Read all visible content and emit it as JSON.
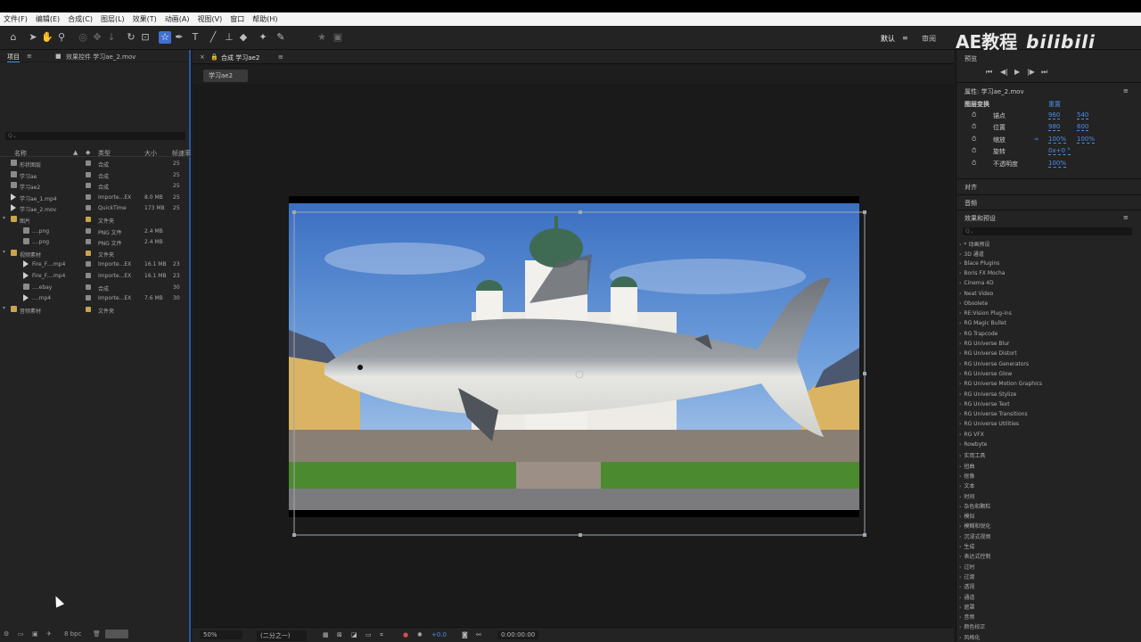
{
  "menu": [
    "文件(F)",
    "编辑(E)",
    "合成(C)",
    "图层(L)",
    "效果(T)",
    "动画(A)",
    "视图(V)",
    "窗口",
    "帮助(H)"
  ],
  "workspace": {
    "default": "默认",
    "review": "审阅"
  },
  "brand": {
    "text": "AE教程",
    "logo": "bilibili"
  },
  "project_panel": {
    "tab_project": "项目",
    "tab_effects": "效果控件 学习ae_2.mov",
    "search_placeholder": "Q⌄",
    "columns": {
      "name": "名称",
      "type": "类型",
      "size": "大小",
      "frame": "帧速率"
    },
    "rows": [
      {
        "name": "形状图层",
        "type": "合成",
        "size": "",
        "frame": "25",
        "kind": "comp",
        "indent": 0
      },
      {
        "name": "学习ae",
        "type": "合成",
        "size": "",
        "frame": "25",
        "kind": "comp",
        "indent": 0
      },
      {
        "name": "学习ae2",
        "type": "合成",
        "size": "",
        "frame": "25",
        "kind": "comp",
        "indent": 0
      },
      {
        "name": "学习ae_1.mp4",
        "type": "Importe...EX",
        "size": "8.0 MB",
        "frame": "25",
        "kind": "video",
        "indent": 0
      },
      {
        "name": "学习ae_2.mov",
        "type": "QuickTime",
        "size": "173 MB",
        "frame": "25",
        "kind": "video",
        "indent": 0
      },
      {
        "name": "图片",
        "type": "文件夹",
        "size": "",
        "frame": "",
        "kind": "folder",
        "indent": 0
      },
      {
        "name": "....png",
        "type": "PNG 文件",
        "size": "2.4 MB",
        "frame": "",
        "kind": "file",
        "indent": 1
      },
      {
        "name": "....png",
        "type": "PNG 文件",
        "size": "2.4 MB",
        "frame": "",
        "kind": "file",
        "indent": 1
      },
      {
        "name": "视频素材",
        "type": "文件夹",
        "size": "",
        "frame": "",
        "kind": "folder",
        "indent": 0
      },
      {
        "name": "Fire_F....mp4",
        "type": "Importe...EX",
        "size": "16.1 MB",
        "frame": "23",
        "kind": "video",
        "indent": 1
      },
      {
        "name": "Fire_F....mp4",
        "type": "Importe...EX",
        "size": "16.1 MB",
        "frame": "23",
        "kind": "video",
        "indent": 1
      },
      {
        "name": "....ebay",
        "type": "合成",
        "size": "",
        "frame": "30",
        "kind": "comp",
        "indent": 1
      },
      {
        "name": "....mp4",
        "type": "Importe...EX",
        "size": "7.6 MB",
        "frame": "30",
        "kind": "video",
        "indent": 1
      },
      {
        "name": "音频素材",
        "type": "文件夹",
        "size": "",
        "frame": "",
        "kind": "folder",
        "indent": 0
      }
    ],
    "footer_bpc": "8 bpc"
  },
  "composition": {
    "tab": "合成 学习ae2",
    "sub_tab": "学习ae2",
    "zoom": "50%",
    "resolution": "(二分之一)",
    "exposure": "+0.0",
    "timecode": "0:00:00:00"
  },
  "right_panel": {
    "preview": "预览",
    "properties_title": "属性: 学习ae_2.mov",
    "layer_transform": "图层变换",
    "reset": "重置",
    "props": [
      {
        "label": "锚点",
        "v1": "960",
        "v2": "540"
      },
      {
        "label": "位置",
        "v1": "980",
        "v2": "600"
      },
      {
        "label": "缩放",
        "v1": "100%",
        "v2": "100%"
      },
      {
        "label": "旋转",
        "v1": "0x+0 °",
        "v2": ""
      },
      {
        "label": "不透明度",
        "v1": "100%",
        "v2": ""
      }
    ],
    "align": "对齐",
    "audio": "音频",
    "effects_presets": "效果和预设",
    "effects_search": "Q⌄",
    "effects": [
      "* 动画预设",
      "3D 通道",
      "Blace Plugins",
      "Boris FX Mocha",
      "Cinema 4D",
      "Neat Video",
      "Obsolete",
      "RE:Vision Plug-ins",
      "RG Magic Bullet",
      "RG Trapcode",
      "RG Universe Blur",
      "RG Universe Distort",
      "RG Universe Generators",
      "RG Universe Glow",
      "RG Universe Motion Graphics",
      "RG Universe Stylize",
      "RG Universe Text",
      "RG Universe Transitions",
      "RG Universe Utilities",
      "RG VFX",
      "Rowbyte",
      "实用工具",
      "扭曲",
      "抠像",
      "文本",
      "时间",
      "杂色和颗粒",
      "模拟",
      "模糊和锐化",
      "沉浸式视频",
      "生成",
      "表达式控制",
      "过时",
      "过渡",
      "透视",
      "通道",
      "遮罩",
      "音频",
      "颜色校正",
      "风格化"
    ]
  },
  "colors": {
    "accent": "#3f6fd0",
    "selection_blue": "#2a55a8",
    "value_blue": "#4a8fe8",
    "folder": "#c9a44e"
  }
}
